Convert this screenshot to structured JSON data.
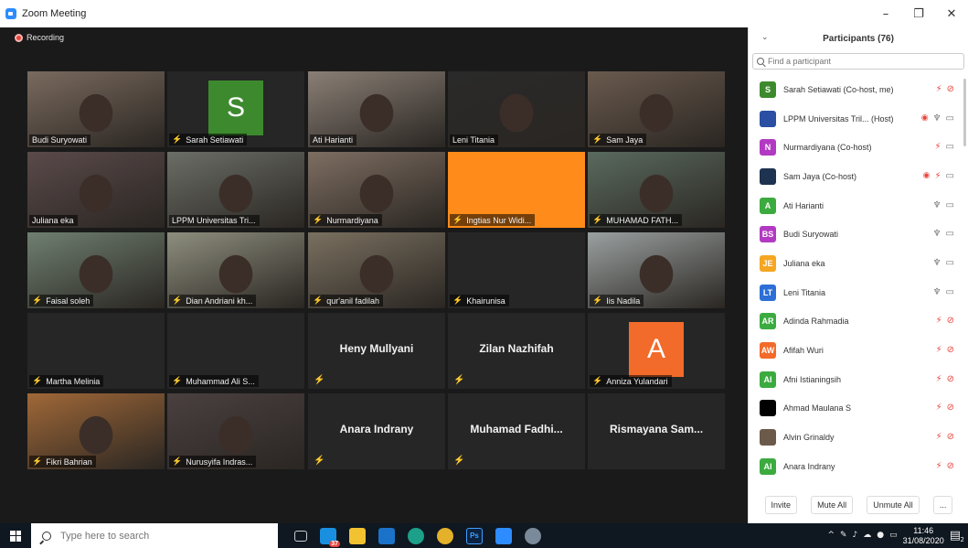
{
  "window": {
    "title": "Zoom Meeting",
    "minimize": "–",
    "restore": "❐",
    "close": "✕"
  },
  "recording_label": "Recording",
  "tiles": [
    {
      "name": "Budi Suryowati",
      "muted": false,
      "type": "video"
    },
    {
      "name": "Sarah Setiawati",
      "muted": true,
      "type": "avatar",
      "letter": "S",
      "color": "#3d8a2e"
    },
    {
      "name": "Ati Harianti",
      "muted": false,
      "type": "video"
    },
    {
      "name": "Leni Titania",
      "muted": false,
      "type": "video"
    },
    {
      "name": "Sam Jaya",
      "muted": true,
      "type": "video"
    },
    {
      "name": "Juliana eka",
      "muted": false,
      "type": "video",
      "active": true
    },
    {
      "name": "LPPM Universitas Tri...",
      "muted": false,
      "type": "video"
    },
    {
      "name": "Nurmardiyana",
      "muted": true,
      "type": "video"
    },
    {
      "name": "Ingtias Nur Widi...",
      "muted": true,
      "type": "solid",
      "color": "#ff8c1a"
    },
    {
      "name": "MUHAMAD FATH...",
      "muted": true,
      "type": "video"
    },
    {
      "name": "Faisal soleh",
      "muted": true,
      "type": "video"
    },
    {
      "name": "Dian Andriani kh...",
      "muted": true,
      "type": "video"
    },
    {
      "name": "qur'anil fadilah",
      "muted": true,
      "type": "video"
    },
    {
      "name": "Khairunisa",
      "muted": true,
      "type": "blank"
    },
    {
      "name": "Iis Nadila",
      "muted": true,
      "type": "video"
    },
    {
      "name": "Martha Melinia",
      "muted": true,
      "type": "blank"
    },
    {
      "name": "Muhammad Ali S...",
      "muted": true,
      "type": "blank"
    },
    {
      "name": "Heny Mullyani",
      "muted": true,
      "type": "bigname"
    },
    {
      "name": "Zilan Nazhifah",
      "muted": true,
      "type": "bigname"
    },
    {
      "name": "Anniza Yulandari",
      "muted": true,
      "type": "avatar",
      "letter": "A",
      "color": "#f26b2a"
    },
    {
      "name": "Fikri Bahrian",
      "muted": true,
      "type": "video"
    },
    {
      "name": "Nurusyifa Indras...",
      "muted": true,
      "type": "video"
    },
    {
      "name": "Anara Indrany",
      "muted": true,
      "type": "bigname"
    },
    {
      "name": "Muhamad Fadhi...",
      "muted": true,
      "type": "bigname"
    },
    {
      "name": "Rismayana Sam...",
      "muted": false,
      "type": "bigname"
    }
  ],
  "panel": {
    "title": "Participants (76)",
    "search_placeholder": "Find a participant",
    "participants": [
      {
        "initials": "S",
        "color": "#3d8a2e",
        "name": "Sarah Setiawati (Co-host, me)",
        "icons": [
          "mic-off",
          "video-off"
        ]
      },
      {
        "initials": "",
        "color": "#2b4fa3",
        "name": "LPPM Universitas Tril... (Host)",
        "icons": [
          "rec",
          "mic",
          "video"
        ]
      },
      {
        "initials": "N",
        "color": "#b23ac2",
        "name": "Nurmardiyana (Co-host)",
        "icons": [
          "mic-off",
          "video"
        ]
      },
      {
        "initials": "",
        "color": "#1e3350",
        "name": "Sam Jaya (Co-host)",
        "icons": [
          "rec",
          "mic-off",
          "video"
        ]
      },
      {
        "initials": "A",
        "color": "#3bab3f",
        "name": "Ati Harianti",
        "icons": [
          "mic",
          "video"
        ]
      },
      {
        "initials": "BS",
        "color": "#b23ac2",
        "name": "Budi Suryowati",
        "icons": [
          "mic",
          "video"
        ]
      },
      {
        "initials": "JE",
        "color": "#f5a623",
        "name": "Juliana eka",
        "icons": [
          "mic-on",
          "video"
        ]
      },
      {
        "initials": "LT",
        "color": "#2d6fd6",
        "name": "Leni Titania",
        "icons": [
          "mic",
          "video"
        ]
      },
      {
        "initials": "AR",
        "color": "#3bab3f",
        "name": "Adinda Rahmadia",
        "icons": [
          "mic-off",
          "video-off"
        ]
      },
      {
        "initials": "AW",
        "color": "#f26b2a",
        "name": "Afifah Wuri",
        "icons": [
          "mic-off",
          "video-off"
        ]
      },
      {
        "initials": "AI",
        "color": "#3bab3f",
        "name": "Afni Istianingsih",
        "icons": [
          "mic-off",
          "video-off"
        ]
      },
      {
        "initials": "",
        "color": "#000000",
        "name": "Ahmad Maulana S",
        "icons": [
          "mic-off",
          "video-off"
        ]
      },
      {
        "initials": "",
        "color": "#6b5a4a",
        "name": "Alvin Grinaldy",
        "icons": [
          "mic-off",
          "video-off"
        ]
      },
      {
        "initials": "AI",
        "color": "#3bab3f",
        "name": "Anara Indrany",
        "icons": [
          "mic-off",
          "video-off"
        ]
      }
    ],
    "buttons": {
      "invite": "Invite",
      "mute_all": "Mute All",
      "unmute_all": "Unmute All",
      "more": "..."
    }
  },
  "taskbar": {
    "search_placeholder": "Type here to search",
    "badge": "37",
    "time": "11:46",
    "date": "31/08/2020",
    "notif_count": "2",
    "apps": [
      "task-view",
      "messenger",
      "file-explorer",
      "mail",
      "edge",
      "chrome",
      "photoshop",
      "zoom",
      "unknown"
    ],
    "app_label_ps": "Ps"
  }
}
